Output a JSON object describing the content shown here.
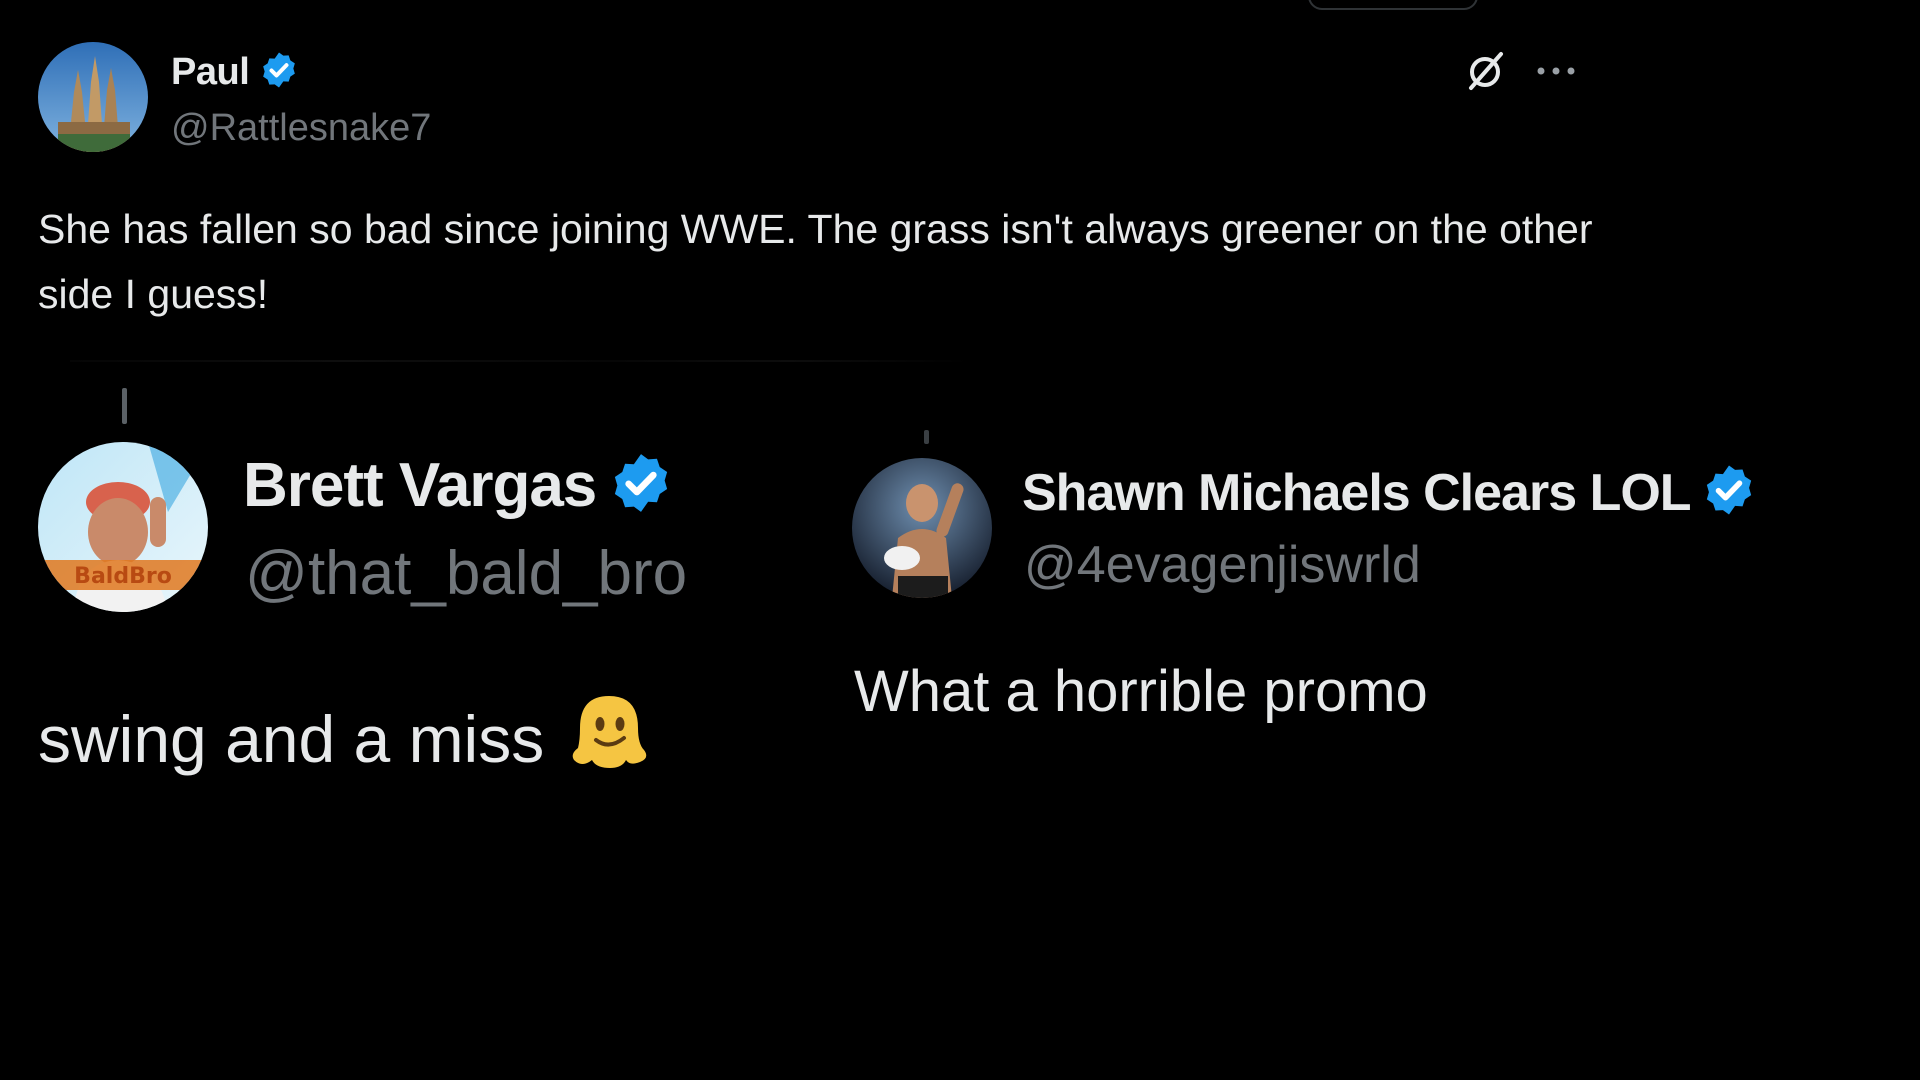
{
  "post": {
    "author_name": "Paul",
    "author_handle": "@Rattlesnake7",
    "text": "She has fallen so bad since joining WWE. The grass isn't always greener on the other side I guess!",
    "more_label": "···"
  },
  "replies": [
    {
      "author_name": "Brett Vargas",
      "author_handle": "@that_bald_bro",
      "text": "swing and a miss",
      "emoji": "melting-face",
      "avatar_text": "BaldBro"
    },
    {
      "author_name": "Shawn Michaels Clears LOL",
      "author_handle": "@4evagenjiswrld",
      "text": "What a horrible promo"
    }
  ],
  "colors": {
    "background": "#000000",
    "text_primary": "#e7e9ea",
    "text_secondary": "#71767b",
    "verified": "#1d9bf0"
  }
}
